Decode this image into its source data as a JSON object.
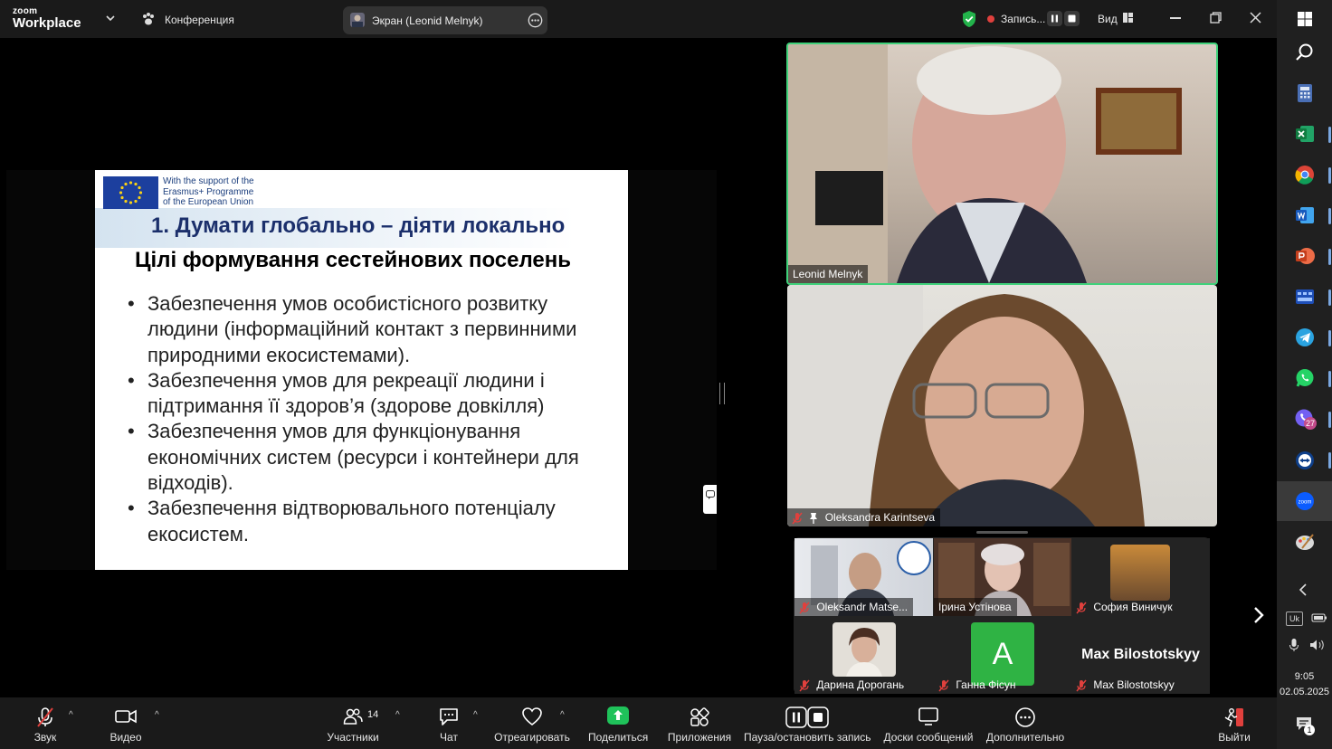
{
  "window": {
    "logo_small": "zoom",
    "logo_big": "Workplace",
    "meeting_menu": "Конференция",
    "screen_share_label": "Экран (Leonid Melnyk)",
    "recording_label": "Запись...",
    "view_label": "Вид"
  },
  "slide": {
    "eu_support_lines": [
      "With the support of the",
      "Erasmus+ Programme",
      "of the European Union"
    ],
    "heading": "1. Думати глобально – діяти локально",
    "subheading": "Цілі формування сестейнових поселень",
    "bullets": [
      "Забезпечення умов особистісного розвитку людини (інформаційний контакт з первинними природними екосистемами).",
      "Забезпечення умов для рекреації людини і підтримання її здоров’я (здорове довкілля)",
      "Забезпечення умов для функціонування економічних систем (ресурси і контейнери для відходів).",
      "Забезпечення відтворювального потенціалу екосистем."
    ]
  },
  "participants_main": [
    {
      "name": "Leonid Melnyk",
      "active_speaker": true
    },
    {
      "name": "Oleksandra Karintseva",
      "muted": true,
      "pinned": true
    }
  ],
  "participants_gallery": [
    {
      "name": "Oleksandr Matse...",
      "muted": true
    },
    {
      "name": "Ірина Устінова",
      "muted": false
    },
    {
      "name": "София Виничук",
      "muted": true
    },
    {
      "name": "Дарина Дорогань",
      "muted": true
    },
    {
      "name": "Ганна Фісун",
      "muted": true,
      "avatar_letter": "A"
    },
    {
      "name": "Max Bilostotskyy",
      "muted": true,
      "display_text": "Max Bilostotskyy"
    }
  ],
  "toolbar": {
    "audio": "Звук",
    "video": "Видео",
    "participants": "Участники",
    "participants_count": "14",
    "chat": "Чат",
    "react": "Отреагировать",
    "share": "Поделиться",
    "apps": "Приложения",
    "record": "Пауза/остановить запись",
    "whiteboards": "Доски сообщений",
    "more": "Дополнительно",
    "leave": "Выйти"
  },
  "taskbar": {
    "lang": "Uk",
    "time": "9:05",
    "date": "02.05.2025",
    "viber_badge": "27",
    "notification_badge": "1"
  },
  "colors": {
    "active_speaker_border": "#3fd17a",
    "mute_red": "#e0403d",
    "share_green": "#1fc25a",
    "eu_blue": "#1c3f9e",
    "slide_heading": "#1b2f6b",
    "gallery_bg": "#232323"
  }
}
